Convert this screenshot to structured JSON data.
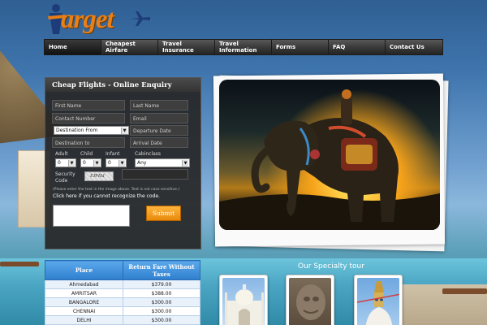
{
  "logo": {
    "text": "arget"
  },
  "nav": {
    "items": [
      {
        "label": "Home"
      },
      {
        "label": "Cheapest Airfare"
      },
      {
        "label": "Travel Insurance"
      },
      {
        "label": "Travel Information"
      },
      {
        "label": "Forms"
      },
      {
        "label": "FAQ"
      },
      {
        "label": "Contact Us"
      }
    ]
  },
  "enquiry": {
    "title": "Cheap Flights - Online Enquiry",
    "first_name": "First Name",
    "last_name": "Last Name",
    "contact_number": "Contact Number",
    "email": "Email",
    "destination_from": "Destination From",
    "departure_date": "Departure Date",
    "destination_to": "Destination to",
    "arrival_date": "Arrival Date",
    "adult_label": "Adult",
    "child_label": "Child",
    "infant_label": "Infant",
    "cabinclass_label": "Cabinclass",
    "adult_value": "0",
    "child_value": "0",
    "infant_value": "0",
    "cabinclass_value": "Any",
    "security_label_1": "Security",
    "security_label_2": "Code",
    "captcha_text": "ЕВЧЫ",
    "note": "(Please enter the text in the image above. Text is not case sensitive.)",
    "refresh_link": "Click here if you cannot recognize the code.",
    "submit_label": "Submit"
  },
  "fares": {
    "headers": [
      "Place",
      "Return Fare Without Taxes"
    ],
    "rows": [
      [
        "Ahmedabad",
        "$379.00"
      ],
      [
        "AMRITSAR",
        "$388.00"
      ],
      [
        "BANGALORE",
        "$300.00"
      ],
      [
        "CHENNAI",
        "$300.00"
      ],
      [
        "DELHI",
        "$300.00"
      ]
    ]
  },
  "specialty": {
    "title": "Our Specialty tour"
  }
}
